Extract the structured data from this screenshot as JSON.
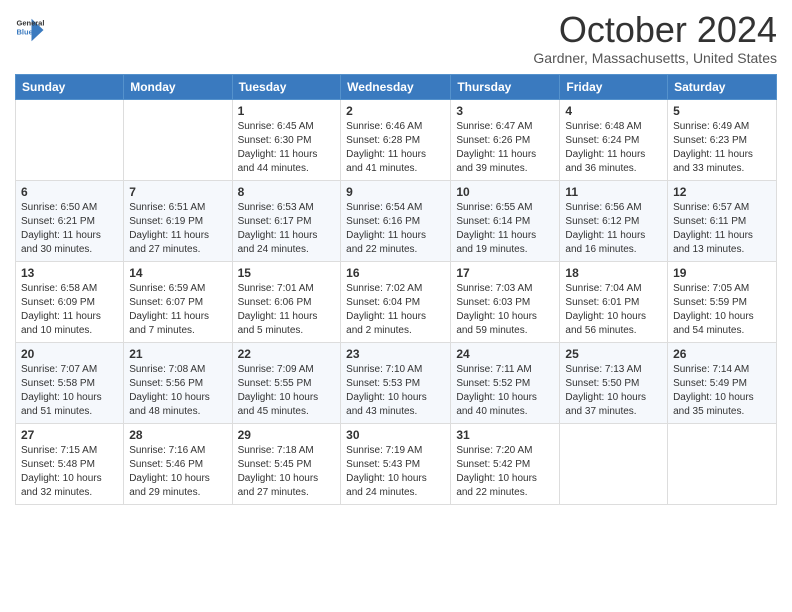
{
  "logo": {
    "line1": "General",
    "line2": "Blue"
  },
  "title": "October 2024",
  "location": "Gardner, Massachusetts, United States",
  "weekdays": [
    "Sunday",
    "Monday",
    "Tuesday",
    "Wednesday",
    "Thursday",
    "Friday",
    "Saturday"
  ],
  "weeks": [
    [
      {
        "day": "",
        "sunrise": "",
        "sunset": "",
        "daylight": ""
      },
      {
        "day": "",
        "sunrise": "",
        "sunset": "",
        "daylight": ""
      },
      {
        "day": "1",
        "sunrise": "Sunrise: 6:45 AM",
        "sunset": "Sunset: 6:30 PM",
        "daylight": "Daylight: 11 hours and 44 minutes."
      },
      {
        "day": "2",
        "sunrise": "Sunrise: 6:46 AM",
        "sunset": "Sunset: 6:28 PM",
        "daylight": "Daylight: 11 hours and 41 minutes."
      },
      {
        "day": "3",
        "sunrise": "Sunrise: 6:47 AM",
        "sunset": "Sunset: 6:26 PM",
        "daylight": "Daylight: 11 hours and 39 minutes."
      },
      {
        "day": "4",
        "sunrise": "Sunrise: 6:48 AM",
        "sunset": "Sunset: 6:24 PM",
        "daylight": "Daylight: 11 hours and 36 minutes."
      },
      {
        "day": "5",
        "sunrise": "Sunrise: 6:49 AM",
        "sunset": "Sunset: 6:23 PM",
        "daylight": "Daylight: 11 hours and 33 minutes."
      }
    ],
    [
      {
        "day": "6",
        "sunrise": "Sunrise: 6:50 AM",
        "sunset": "Sunset: 6:21 PM",
        "daylight": "Daylight: 11 hours and 30 minutes."
      },
      {
        "day": "7",
        "sunrise": "Sunrise: 6:51 AM",
        "sunset": "Sunset: 6:19 PM",
        "daylight": "Daylight: 11 hours and 27 minutes."
      },
      {
        "day": "8",
        "sunrise": "Sunrise: 6:53 AM",
        "sunset": "Sunset: 6:17 PM",
        "daylight": "Daylight: 11 hours and 24 minutes."
      },
      {
        "day": "9",
        "sunrise": "Sunrise: 6:54 AM",
        "sunset": "Sunset: 6:16 PM",
        "daylight": "Daylight: 11 hours and 22 minutes."
      },
      {
        "day": "10",
        "sunrise": "Sunrise: 6:55 AM",
        "sunset": "Sunset: 6:14 PM",
        "daylight": "Daylight: 11 hours and 19 minutes."
      },
      {
        "day": "11",
        "sunrise": "Sunrise: 6:56 AM",
        "sunset": "Sunset: 6:12 PM",
        "daylight": "Daylight: 11 hours and 16 minutes."
      },
      {
        "day": "12",
        "sunrise": "Sunrise: 6:57 AM",
        "sunset": "Sunset: 6:11 PM",
        "daylight": "Daylight: 11 hours and 13 minutes."
      }
    ],
    [
      {
        "day": "13",
        "sunrise": "Sunrise: 6:58 AM",
        "sunset": "Sunset: 6:09 PM",
        "daylight": "Daylight: 11 hours and 10 minutes."
      },
      {
        "day": "14",
        "sunrise": "Sunrise: 6:59 AM",
        "sunset": "Sunset: 6:07 PM",
        "daylight": "Daylight: 11 hours and 7 minutes."
      },
      {
        "day": "15",
        "sunrise": "Sunrise: 7:01 AM",
        "sunset": "Sunset: 6:06 PM",
        "daylight": "Daylight: 11 hours and 5 minutes."
      },
      {
        "day": "16",
        "sunrise": "Sunrise: 7:02 AM",
        "sunset": "Sunset: 6:04 PM",
        "daylight": "Daylight: 11 hours and 2 minutes."
      },
      {
        "day": "17",
        "sunrise": "Sunrise: 7:03 AM",
        "sunset": "Sunset: 6:03 PM",
        "daylight": "Daylight: 10 hours and 59 minutes."
      },
      {
        "day": "18",
        "sunrise": "Sunrise: 7:04 AM",
        "sunset": "Sunset: 6:01 PM",
        "daylight": "Daylight: 10 hours and 56 minutes."
      },
      {
        "day": "19",
        "sunrise": "Sunrise: 7:05 AM",
        "sunset": "Sunset: 5:59 PM",
        "daylight": "Daylight: 10 hours and 54 minutes."
      }
    ],
    [
      {
        "day": "20",
        "sunrise": "Sunrise: 7:07 AM",
        "sunset": "Sunset: 5:58 PM",
        "daylight": "Daylight: 10 hours and 51 minutes."
      },
      {
        "day": "21",
        "sunrise": "Sunrise: 7:08 AM",
        "sunset": "Sunset: 5:56 PM",
        "daylight": "Daylight: 10 hours and 48 minutes."
      },
      {
        "day": "22",
        "sunrise": "Sunrise: 7:09 AM",
        "sunset": "Sunset: 5:55 PM",
        "daylight": "Daylight: 10 hours and 45 minutes."
      },
      {
        "day": "23",
        "sunrise": "Sunrise: 7:10 AM",
        "sunset": "Sunset: 5:53 PM",
        "daylight": "Daylight: 10 hours and 43 minutes."
      },
      {
        "day": "24",
        "sunrise": "Sunrise: 7:11 AM",
        "sunset": "Sunset: 5:52 PM",
        "daylight": "Daylight: 10 hours and 40 minutes."
      },
      {
        "day": "25",
        "sunrise": "Sunrise: 7:13 AM",
        "sunset": "Sunset: 5:50 PM",
        "daylight": "Daylight: 10 hours and 37 minutes."
      },
      {
        "day": "26",
        "sunrise": "Sunrise: 7:14 AM",
        "sunset": "Sunset: 5:49 PM",
        "daylight": "Daylight: 10 hours and 35 minutes."
      }
    ],
    [
      {
        "day": "27",
        "sunrise": "Sunrise: 7:15 AM",
        "sunset": "Sunset: 5:48 PM",
        "daylight": "Daylight: 10 hours and 32 minutes."
      },
      {
        "day": "28",
        "sunrise": "Sunrise: 7:16 AM",
        "sunset": "Sunset: 5:46 PM",
        "daylight": "Daylight: 10 hours and 29 minutes."
      },
      {
        "day": "29",
        "sunrise": "Sunrise: 7:18 AM",
        "sunset": "Sunset: 5:45 PM",
        "daylight": "Daylight: 10 hours and 27 minutes."
      },
      {
        "day": "30",
        "sunrise": "Sunrise: 7:19 AM",
        "sunset": "Sunset: 5:43 PM",
        "daylight": "Daylight: 10 hours and 24 minutes."
      },
      {
        "day": "31",
        "sunrise": "Sunrise: 7:20 AM",
        "sunset": "Sunset: 5:42 PM",
        "daylight": "Daylight: 10 hours and 22 minutes."
      },
      {
        "day": "",
        "sunrise": "",
        "sunset": "",
        "daylight": ""
      },
      {
        "day": "",
        "sunrise": "",
        "sunset": "",
        "daylight": ""
      }
    ]
  ]
}
